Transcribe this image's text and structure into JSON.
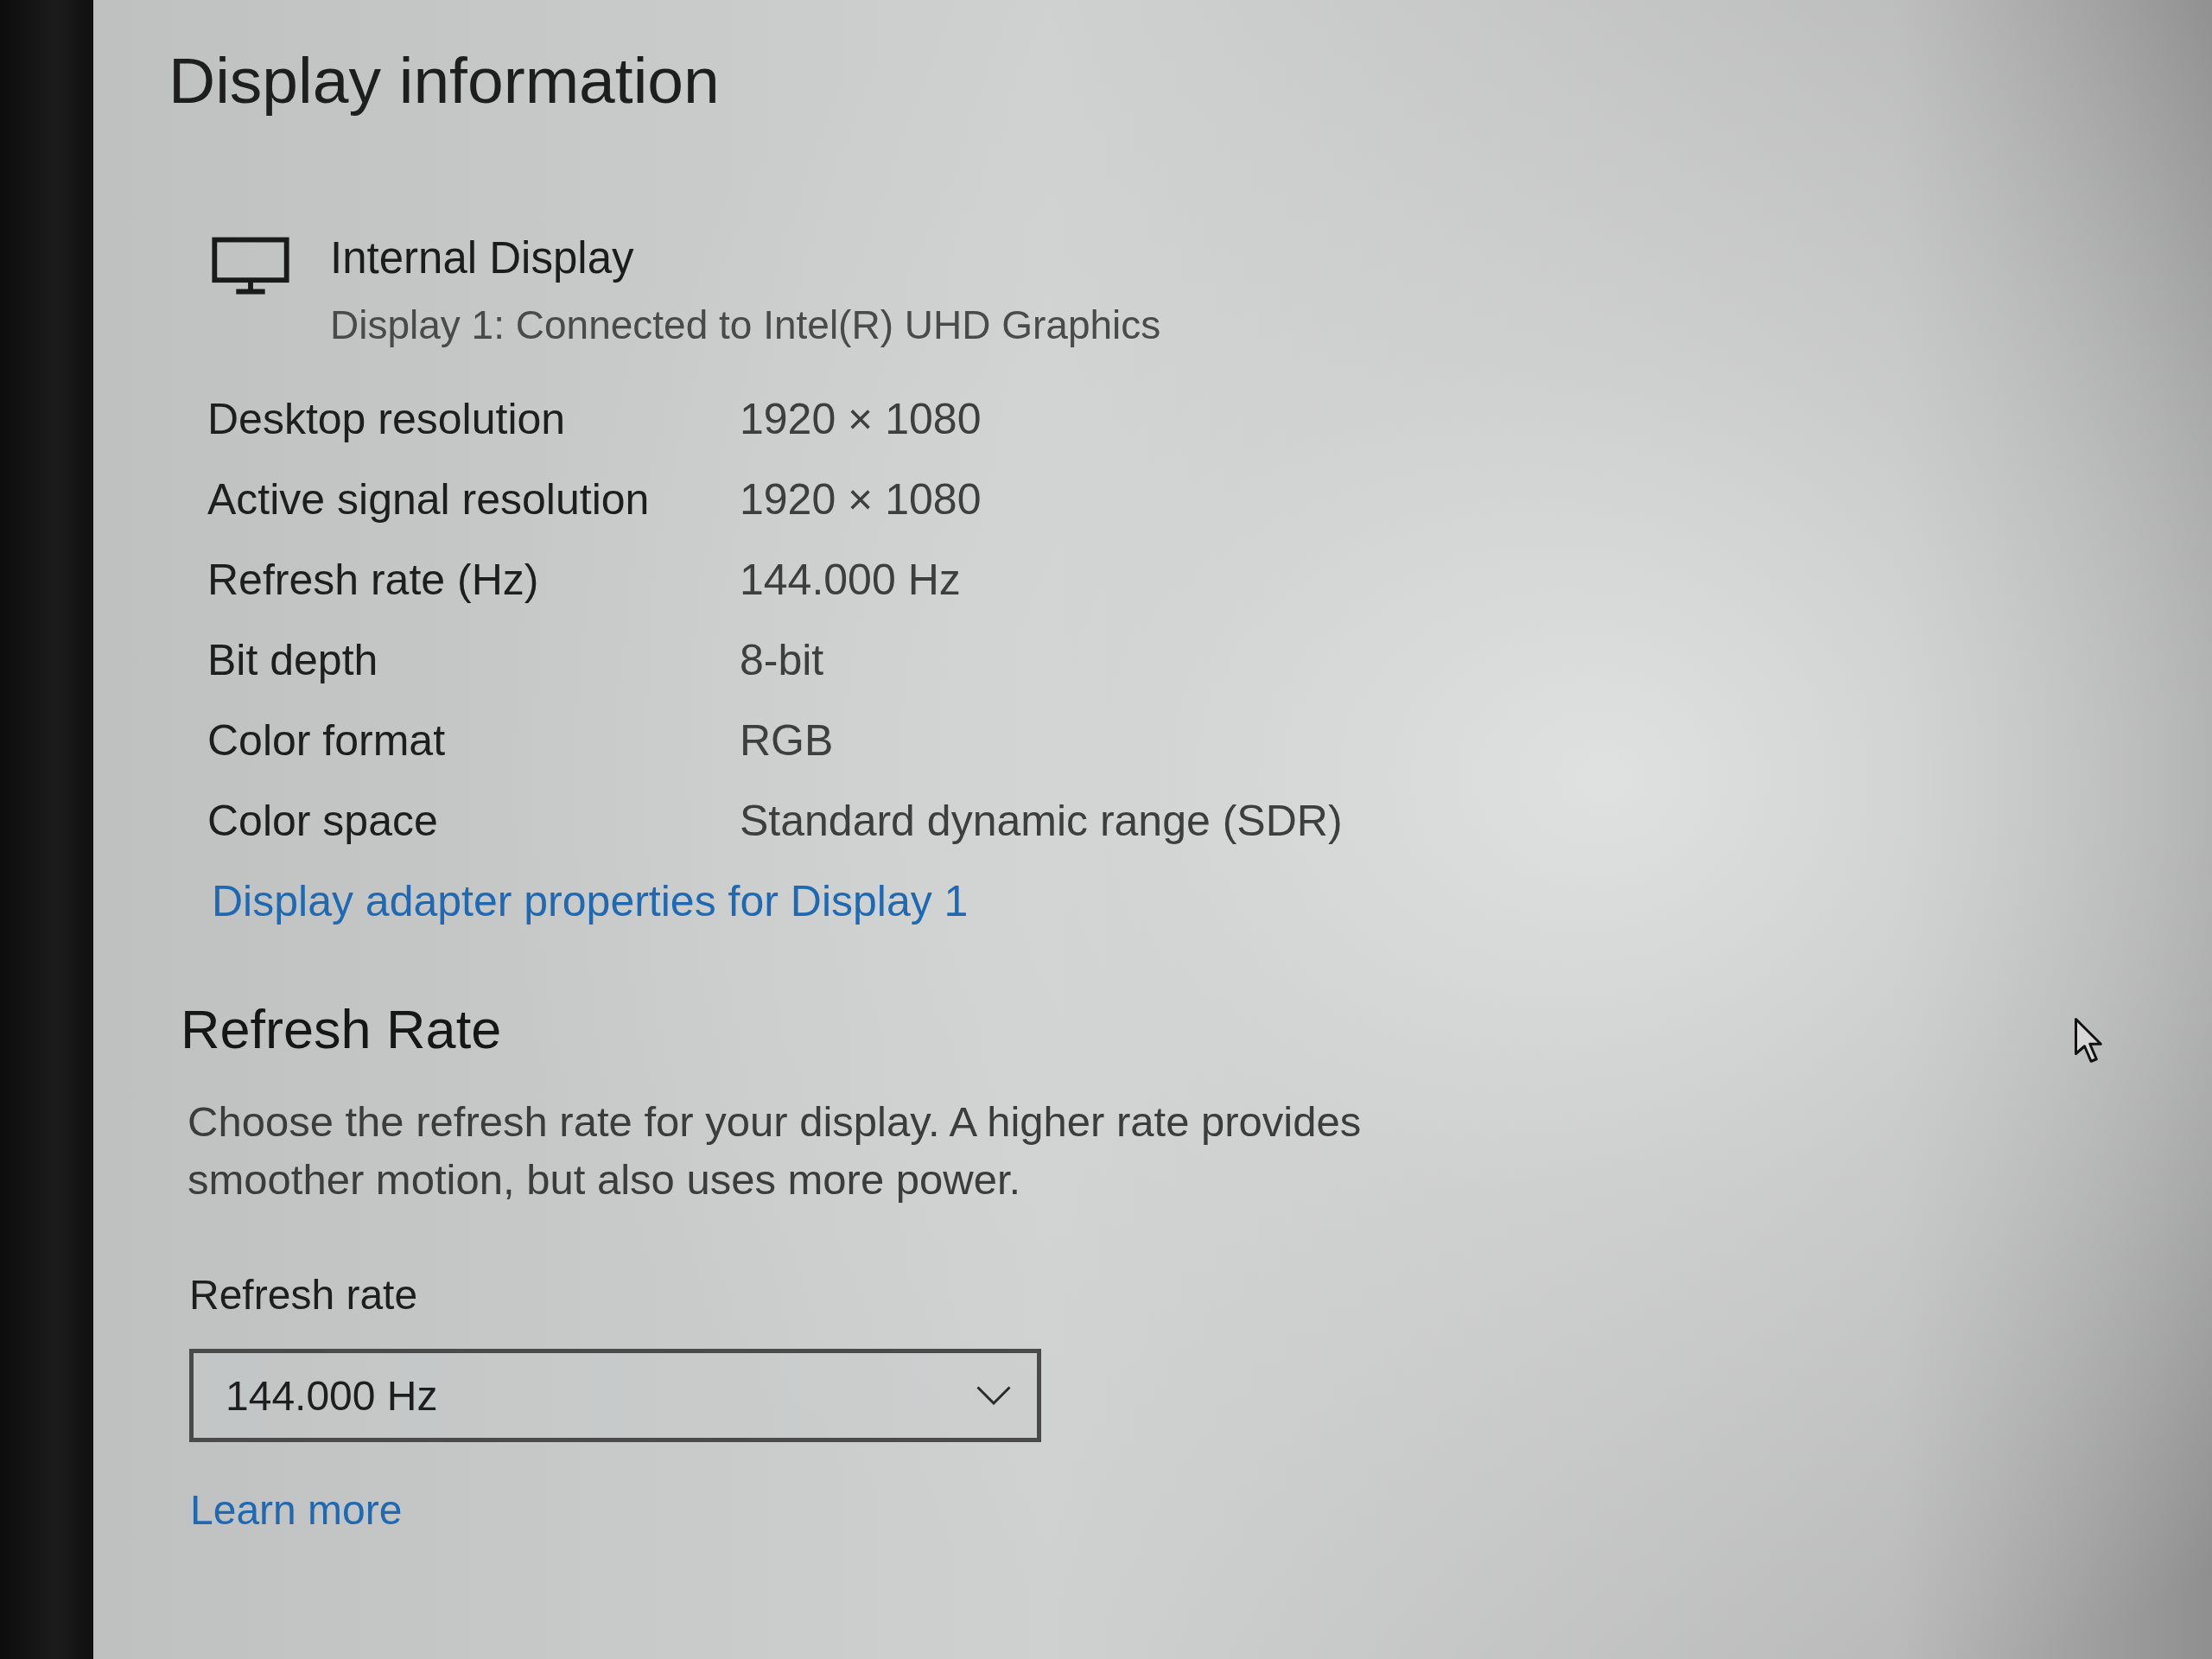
{
  "display_information": {
    "title": "Display information",
    "display": {
      "name": "Internal Display",
      "detail": "Display 1: Connected to Intel(R) UHD Graphics"
    },
    "properties": [
      {
        "label": "Desktop resolution",
        "value": "1920 × 1080"
      },
      {
        "label": "Active signal resolution",
        "value": "1920 × 1080"
      },
      {
        "label": "Refresh rate (Hz)",
        "value": "144.000 Hz"
      },
      {
        "label": "Bit depth",
        "value": "8-bit"
      },
      {
        "label": "Color format",
        "value": "RGB"
      },
      {
        "label": "Color space",
        "value": "Standard dynamic range (SDR)"
      }
    ],
    "link": "Display adapter properties for Display 1"
  },
  "refresh_rate": {
    "title": "Refresh Rate",
    "description": "Choose the refresh rate for your display. A higher rate provides smoother motion, but also uses more power.",
    "field_label": "Refresh rate",
    "dropdown": {
      "value": "144.000 Hz"
    },
    "link": "Learn more"
  }
}
